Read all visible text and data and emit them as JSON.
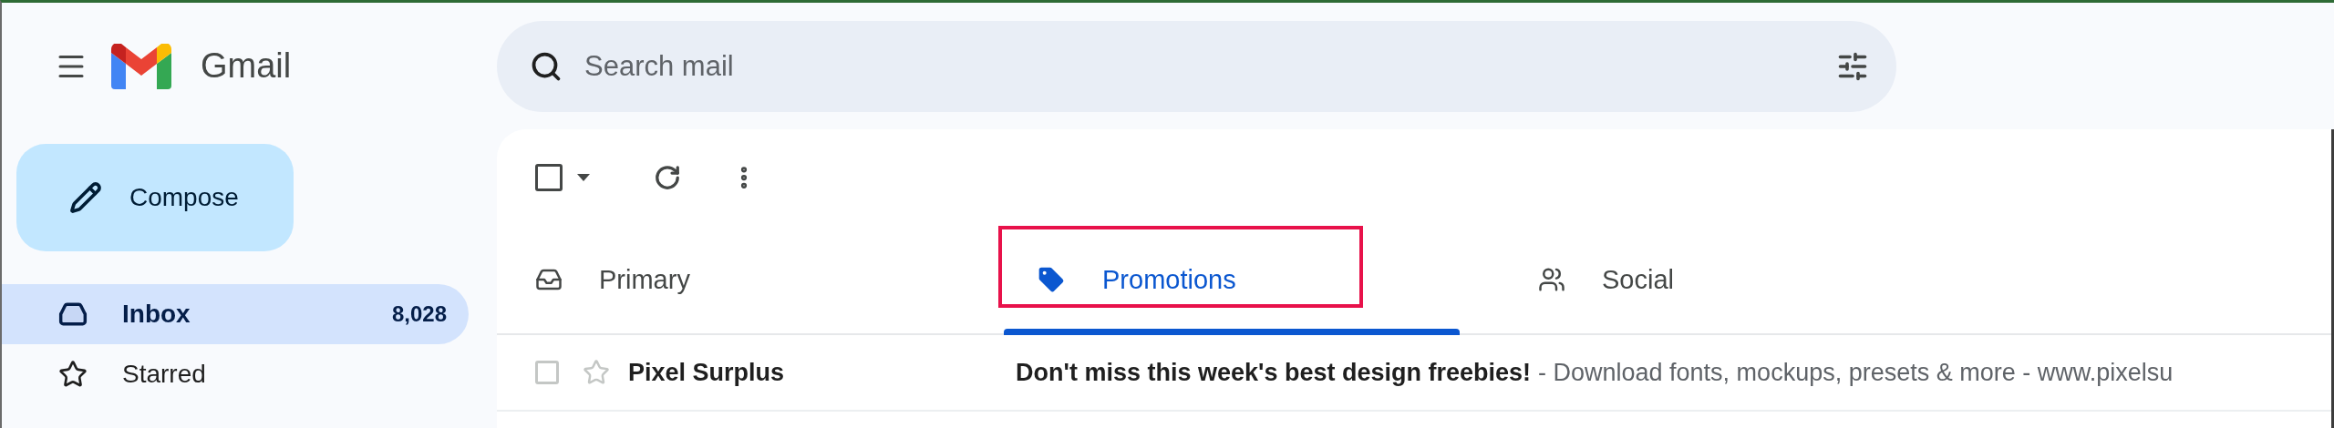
{
  "header": {
    "app_name": "Gmail",
    "search": {
      "placeholder": "Search mail"
    }
  },
  "compose": {
    "label": "Compose"
  },
  "sidebar": {
    "items": [
      {
        "kind": "inbox",
        "label": "Inbox",
        "count": "8,028",
        "selected": true
      },
      {
        "kind": "star",
        "label": "Starred",
        "selected": false
      }
    ]
  },
  "toolbar": {
    "select_all": {
      "checked": false
    }
  },
  "tabs": [
    {
      "kind": "inbox",
      "label": "Primary",
      "selected": false,
      "highlighted": false
    },
    {
      "kind": "tag",
      "label": "Promotions",
      "selected": true,
      "highlighted": true
    },
    {
      "kind": "people",
      "label": "Social",
      "selected": false,
      "highlighted": false
    }
  ],
  "emails": [
    {
      "sender": "Pixel Surplus",
      "subject": "Don't miss this week's best design freebies!",
      "snippet": "- Download fonts, mockups, presets & more - www.pixelsu",
      "unread": true,
      "starred": false,
      "checked": false
    }
  ]
}
